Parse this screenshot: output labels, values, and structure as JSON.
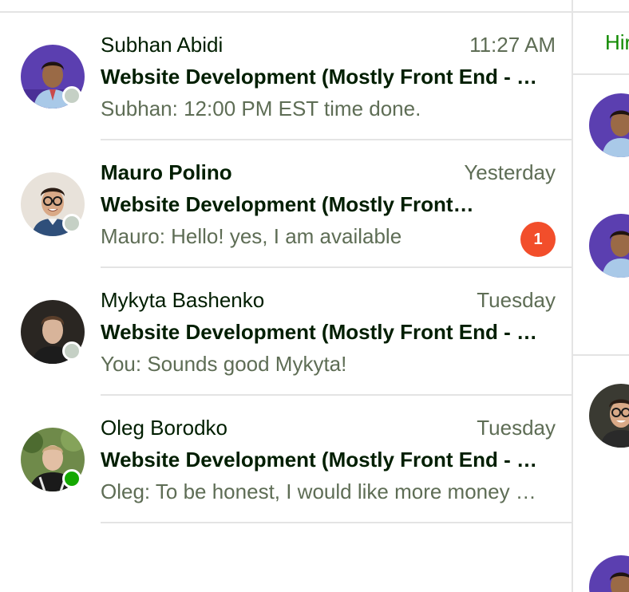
{
  "conversations": [
    {
      "name": "Subhan Abidi",
      "time": "11:27 AM",
      "job": "Website Development (Mostly Front End - …",
      "preview": "Subhan: 12:00 PM EST time done.",
      "status": "offline",
      "unread": false,
      "avatar_icon": "person-avatar-purple"
    },
    {
      "name": "Mauro Polino",
      "time": "Yesterday",
      "job": "Website Development (Mostly Front…",
      "preview": "Mauro: Hello! yes, I am available",
      "status": "offline",
      "unread": true,
      "unread_count": "1",
      "avatar_icon": "person-avatar-glasses"
    },
    {
      "name": "Mykyta Bashenko",
      "time": "Tuesday",
      "job": "Website Development (Mostly Front End - …",
      "preview": "You: Sounds good Mykyta!",
      "status": "offline",
      "unread": false,
      "avatar_icon": "person-avatar-dark"
    },
    {
      "name": "Oleg Borodko",
      "time": "Tuesday",
      "job": "Website Development (Mostly Front End - …",
      "preview": "Oleg: To be honest, I would like more money …",
      "status": "online",
      "unread": false,
      "avatar_icon": "person-avatar-outdoor"
    }
  ],
  "right_pane": {
    "heading": "Hir"
  },
  "colors": {
    "brand_green": "#108a00",
    "text_dark": "#001e00",
    "text_muted": "#5e6d55",
    "status_online": "#14a800",
    "status_offline": "#c5d0c5",
    "badge": "#f24e2b",
    "divider": "#e4e4e4"
  }
}
